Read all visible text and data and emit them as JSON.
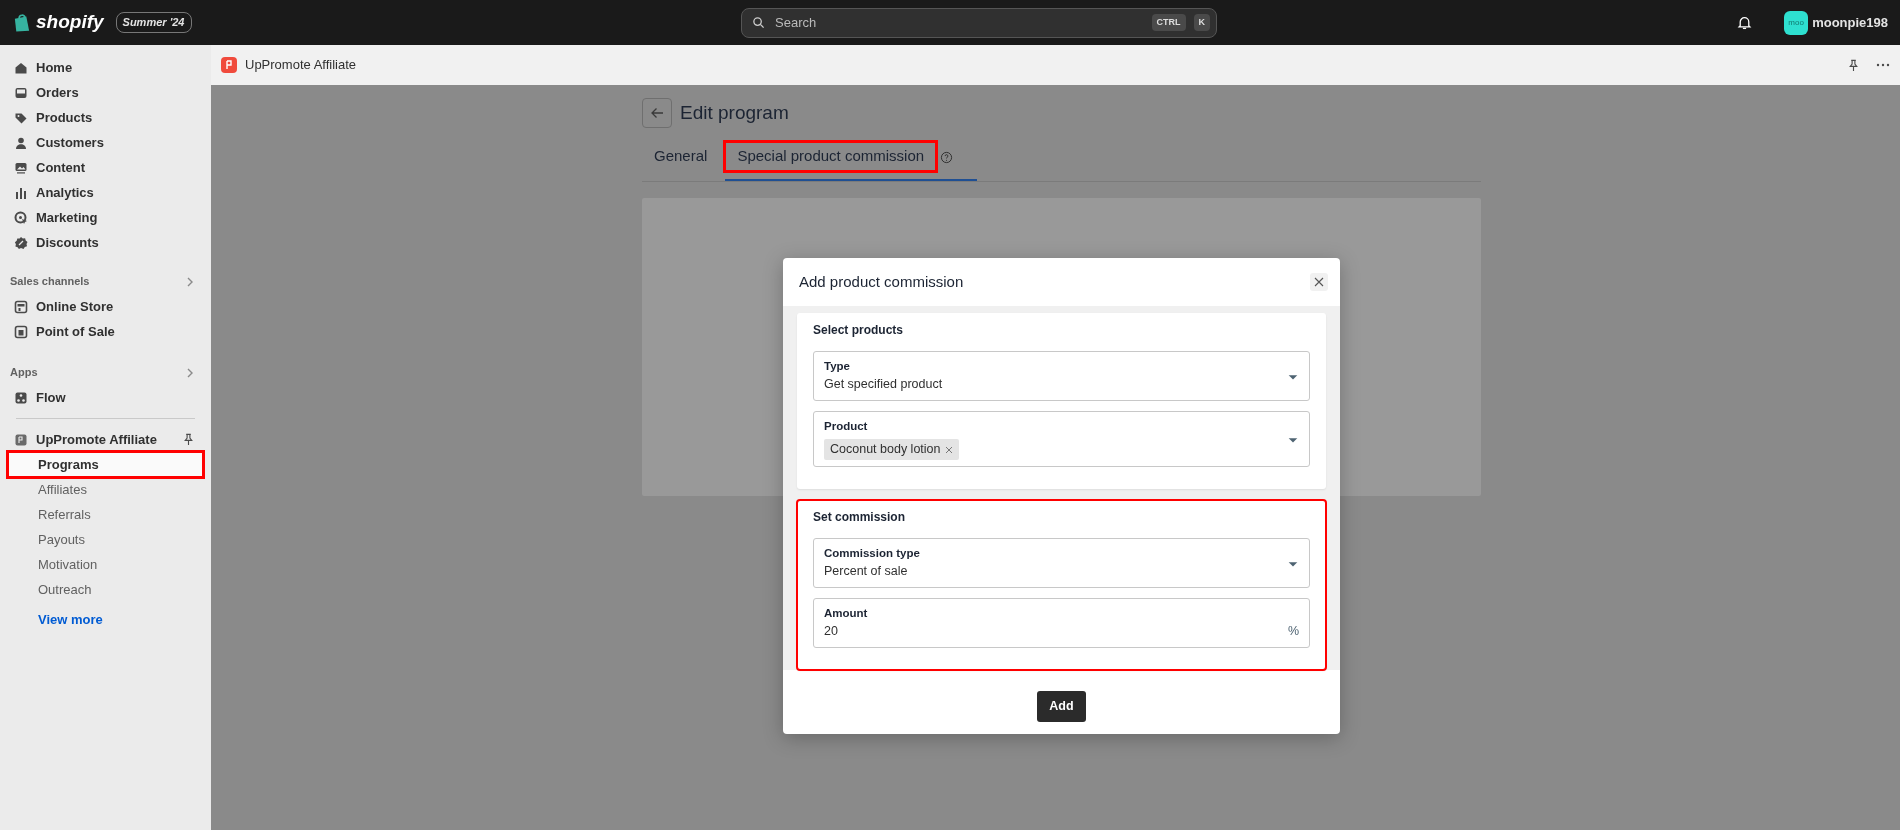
{
  "topbar": {
    "brand": "shopify",
    "edition": "Summer '24",
    "search": {
      "placeholder": "Search",
      "keys": [
        "CTRL",
        "K"
      ]
    },
    "avatar": "moo",
    "user": "moonpie198"
  },
  "sidebar": {
    "items": [
      {
        "label": "Home"
      },
      {
        "label": "Orders"
      },
      {
        "label": "Products"
      },
      {
        "label": "Customers"
      },
      {
        "label": "Content"
      },
      {
        "label": "Analytics"
      },
      {
        "label": "Marketing"
      },
      {
        "label": "Discounts"
      }
    ],
    "sections": [
      {
        "title": "Sales channels",
        "items": [
          {
            "label": "Online Store"
          },
          {
            "label": "Point of Sale"
          }
        ]
      },
      {
        "title": "Apps",
        "items": [
          {
            "label": "Flow"
          }
        ]
      }
    ],
    "app": {
      "label": "UpPromote Affiliate",
      "children": [
        {
          "label": "Programs",
          "selected": true,
          "highlighted": true
        },
        {
          "label": "Affiliates",
          "selected": false,
          "highlighted": false
        },
        {
          "label": "Referrals",
          "selected": false,
          "highlighted": false
        },
        {
          "label": "Payouts",
          "selected": false,
          "highlighted": false
        },
        {
          "label": "Motivation",
          "selected": false,
          "highlighted": false
        },
        {
          "label": "Outreach",
          "selected": false,
          "highlighted": false
        }
      ],
      "more": "View more"
    }
  },
  "app_bar": {
    "title": "UpPromote Affiliate"
  },
  "page": {
    "title": "Edit program",
    "tabs": [
      {
        "label": "General",
        "selected": false,
        "highlighted": false
      },
      {
        "label": "Special product commission",
        "selected": true,
        "highlighted": true
      }
    ]
  },
  "modal": {
    "title": "Add product commission",
    "sections": [
      {
        "title": "Select products",
        "highlighted": false,
        "fields": [
          {
            "kind": "select",
            "label": "Type",
            "value": "Get specified product"
          },
          {
            "kind": "tags",
            "label": "Product",
            "tags": [
              "Coconut body lotion"
            ]
          }
        ]
      },
      {
        "title": "Set commission",
        "highlighted": true,
        "fields": [
          {
            "kind": "select",
            "label": "Commission type",
            "value": "Percent of sale"
          },
          {
            "kind": "input",
            "label": "Amount",
            "value": "20",
            "suffix": "%"
          }
        ]
      }
    ],
    "button": "Add"
  }
}
